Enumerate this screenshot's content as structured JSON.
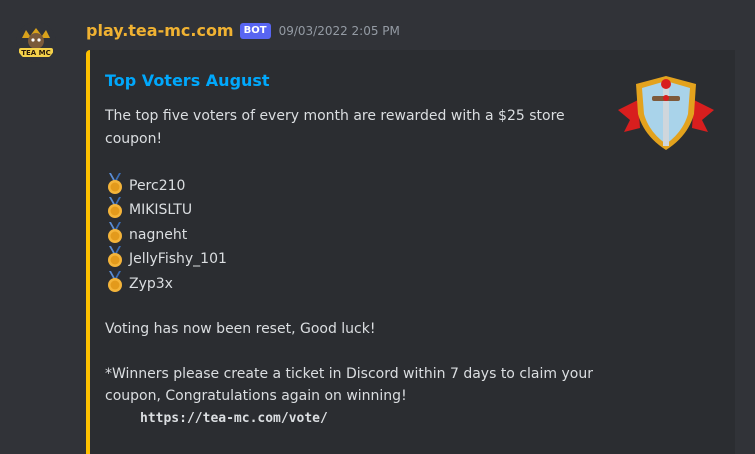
{
  "author": {
    "name": "play.tea-mc.com",
    "bot_tag": "BOT",
    "timestamp": "09/03/2022 2:05 PM",
    "avatar_label": "TEA MC"
  },
  "embed": {
    "accent_color": "#fec100",
    "title": "Top Voters August",
    "intro": "The top five voters of every month are rewarded with a $25 store coupon!",
    "medal_icon": "sports-medal-icon",
    "voters": [
      "Perc210",
      "MIKISLTU",
      "nagneht",
      "JellyFishy_101",
      "Zyp3x"
    ],
    "reset_text": "Voting has now been reset, Good luck!",
    "winners_note": "*Winners please create a ticket in Discord within 7 days to claim your coupon, Congratulations again on winning!",
    "link": "https://tea-mc.com/vote/",
    "thumbnail_icon": "shield-sword-icon"
  }
}
